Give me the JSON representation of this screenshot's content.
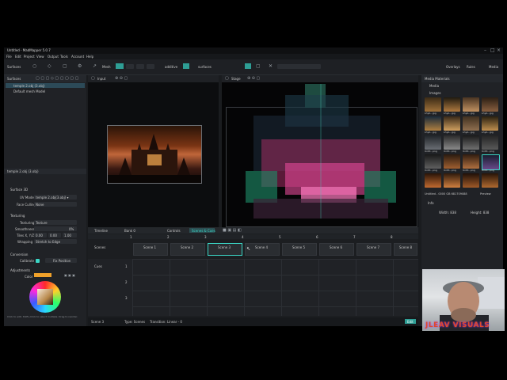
{
  "window": {
    "title": "Untitled - MadMapper 5.0.7"
  },
  "menu": [
    "File",
    "Edit",
    "Project",
    "View",
    "Output",
    "Tools",
    "Account",
    "Help"
  ],
  "toolbar": {
    "surfaces_label": "Surfaces",
    "mesh_label": "Mesh",
    "additive_label": "additive",
    "surfaces2_label": "surfaces",
    "overlays_label": "Overlays",
    "rules_label": "Rules",
    "media_label": "Media"
  },
  "surfaces_panel": {
    "title": "Surfaces",
    "items": [
      "temple 2.obj (3.obj)",
      "Default mesh Model"
    ],
    "selected_label": "temple 2.obj (3.obj)",
    "sections": {
      "material": "Surface 3D",
      "uv_mode_label": "UV Mode",
      "uv_mode_value": "temple 2.obj(3.obj) ▾",
      "face_culling_label": "Face Culling",
      "face_culling_value": "None",
      "texturing": "Texturing",
      "texturing_label": "Texturing",
      "texturing_value": "Texture",
      "smoothness_label": "Smoothness",
      "smoothness_value": "0%",
      "tiles_label": "Tiles X, Y/Z",
      "tiles_values": [
        "0.00",
        "0.00",
        "1.00"
      ],
      "wrapping_label": "Wrapping",
      "wrapping_value": "Stretch to Edge",
      "conversion": "Conversion",
      "calibrate_label": "Calibrate",
      "fix_position": "Fix Position",
      "adjustments": "Adjustments",
      "color_label": "Color"
    },
    "hint": "Click to edit. Shift+Click to select multiple. Drag to reorder."
  },
  "input_view": {
    "label": "Input"
  },
  "stage_view": {
    "label": "Stage"
  },
  "media_panel": {
    "title": "Media Materials",
    "tab": "Media",
    "folder": "Images",
    "thumb_captions": [
      "Lhyb...jpg",
      "Lhyb...jpg",
      "Lhyb...jpg",
      "Lhyb...jpg",
      "Lhyb...jpg",
      "Lhyb...jpg",
      "Lhyb...jpg",
      "Lhyb...jpg",
      "Untit...png",
      "Untit...png",
      "Untit...png",
      "Untit...png",
      "Untit...png",
      "Untit...png",
      "Untit...png",
      "Untit...png",
      "Untit...png",
      "Untit...png",
      "Untit...png",
      "Untit...png",
      "Untit...png",
      "Untit...png",
      "Untit...png",
      "Untit...png"
    ],
    "selected_name": "Untitled - 0000 GB 681709088",
    "preview_label": "Preview",
    "info_section": "Info",
    "width_label": "Width: 838",
    "height_label": "Height: 838"
  },
  "timeline": {
    "timeline_tab": "Timeline",
    "bank_label": "Bank 0",
    "controls_tab": "Controls",
    "scenes_tab": "Scenes & Cues",
    "columns": [
      "1",
      "2",
      "3",
      "4",
      "5",
      "6",
      "7",
      "8"
    ],
    "row_label": "Scenes",
    "scenes": [
      "Scene 1",
      "Scene 2",
      "Scene 3",
      "Scene 4",
      "Scene 5",
      "Scene 6",
      "Scene 7",
      "Scene 8"
    ],
    "lower_row_label": "Cues",
    "lower_numbers": [
      "1",
      "2",
      "3"
    ],
    "footer_left": "Scene 3",
    "footer_type": "Type: Scenes",
    "footer_transition": "Transition: Linear - 0",
    "footer_button": "Edit"
  },
  "webcam": {
    "overlay_text": "JLEAV VISUALS"
  },
  "colors": {
    "accent": "#3bd6c6",
    "panel": "#202226",
    "background": "#1a1c1f"
  }
}
